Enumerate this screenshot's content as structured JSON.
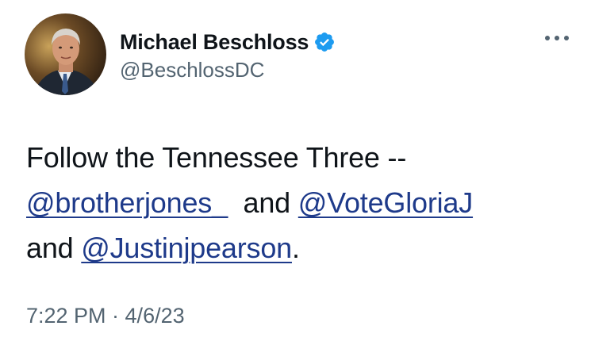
{
  "tweet": {
    "author": {
      "display_name": "Michael Beschloss",
      "handle": "@BeschlossDC",
      "verified": true,
      "avatar_icon": "profile-photo"
    },
    "more_icon": "ellipsis-horizontal-icon",
    "text": {
      "line1": "Follow the Tennessee Three --",
      "mention1": "@brotherjones_",
      "and1": "and",
      "mention2": "@VoteGloriaJ",
      "and2": "and",
      "mention3": "@Justinjpearson",
      "period": "."
    },
    "timestamp": "7:22 PM · 4/6/23"
  },
  "colors": {
    "mention": "#1e3a8a",
    "verified_badge": "#1d9bf0",
    "secondary_text": "#536471",
    "primary_text": "#0f1419"
  }
}
